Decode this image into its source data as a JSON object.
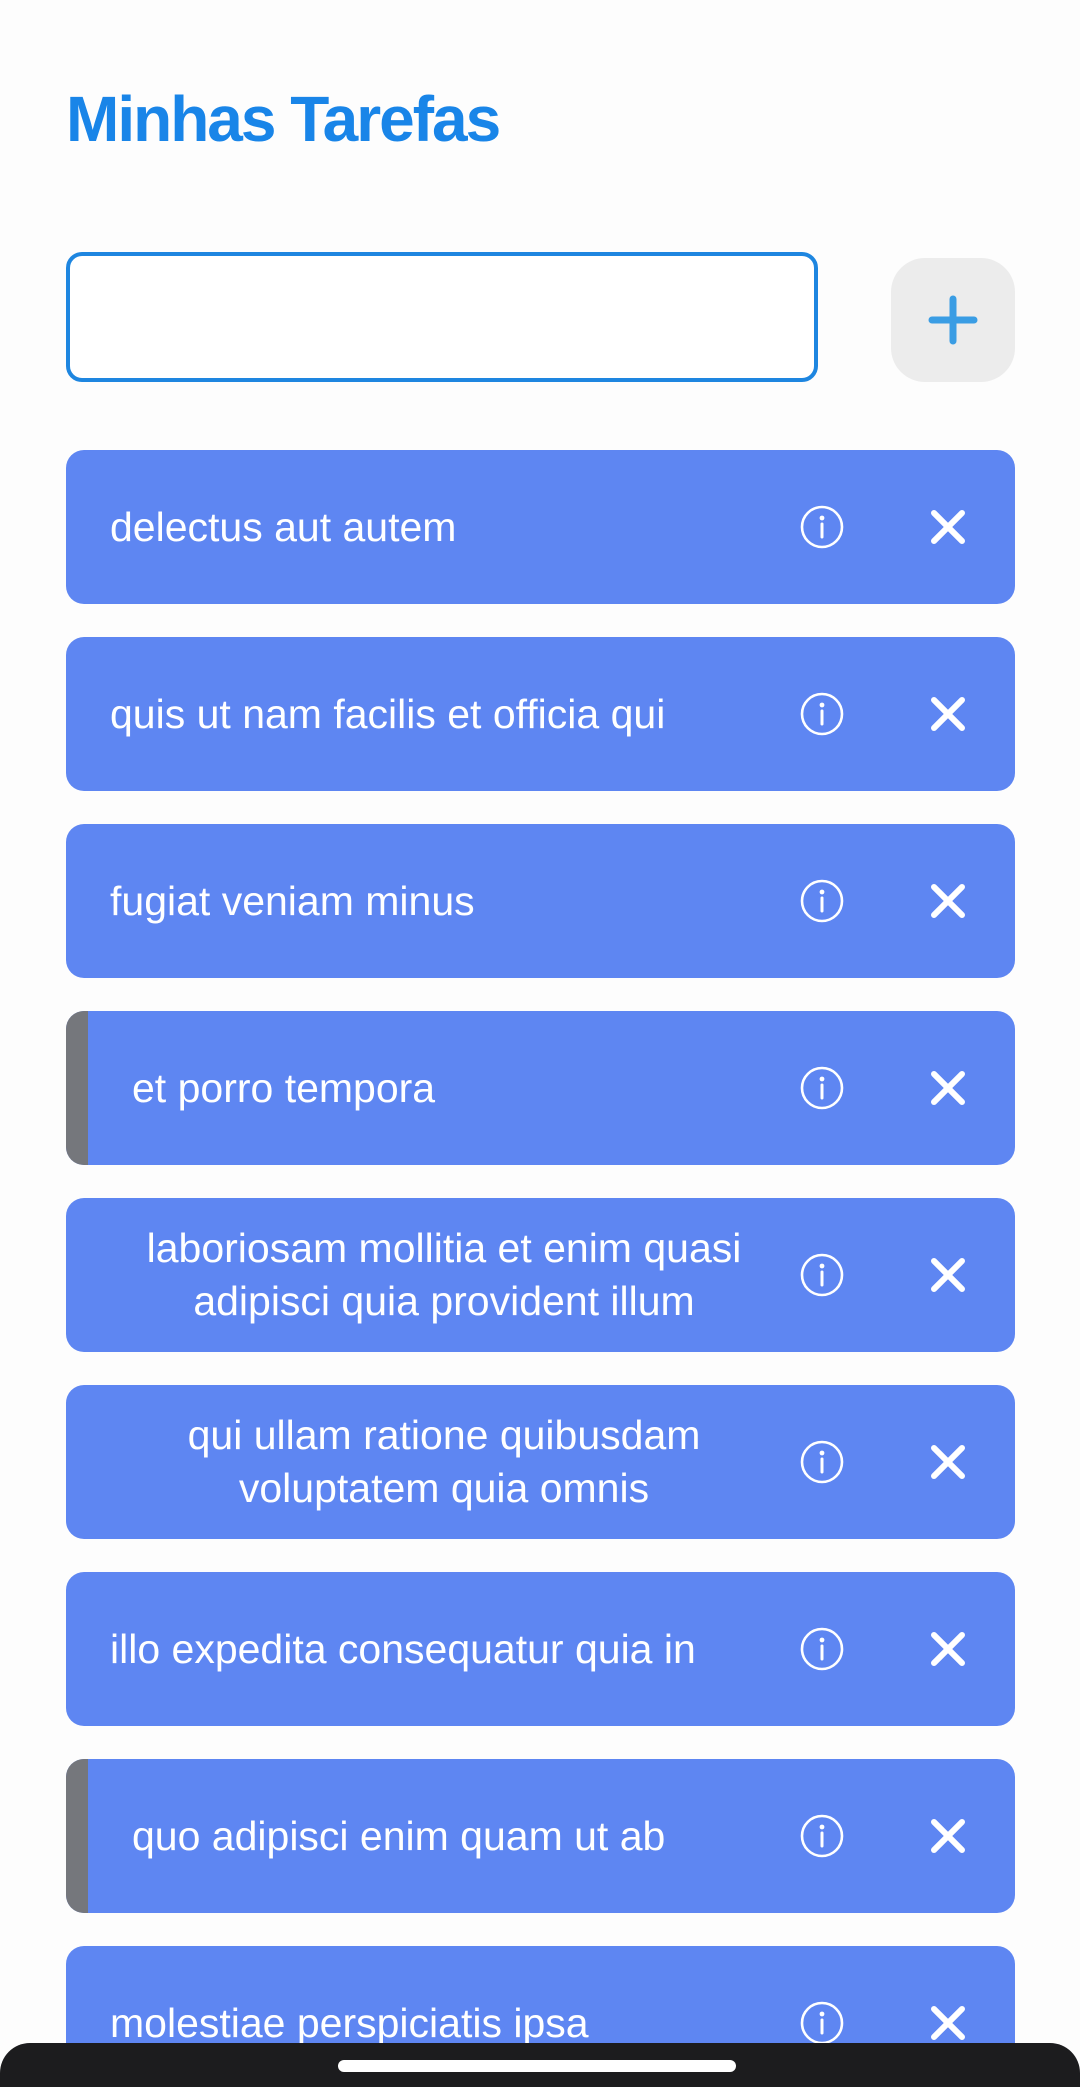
{
  "header": {
    "title": "Minhas Tarefas"
  },
  "new_task": {
    "value": "",
    "placeholder": "",
    "add_icon": "plus-icon"
  },
  "colors": {
    "accent": "#1985e8",
    "task_background": "#5e86f2",
    "completed_marker": "#75777c",
    "add_button_background": "#ececec"
  },
  "tasks": [
    {
      "title": "delectus aut autem",
      "completed": false
    },
    {
      "title": "quis ut nam facilis et officia qui",
      "completed": false
    },
    {
      "title": "fugiat veniam minus",
      "completed": false
    },
    {
      "title": "et porro tempora",
      "completed": true
    },
    {
      "title": "laboriosam mollitia et enim quasi adipisci quia provident illum",
      "completed": false
    },
    {
      "title": "qui ullam ratione quibusdam voluptatem quia omnis",
      "completed": false
    },
    {
      "title": "illo expedita consequatur quia in",
      "completed": false
    },
    {
      "title": "quo adipisci enim quam ut ab",
      "completed": true
    },
    {
      "title": "molestiae perspiciatis ipsa",
      "completed": false
    }
  ],
  "task_icons": {
    "info": "info-icon",
    "delete": "close-icon"
  }
}
